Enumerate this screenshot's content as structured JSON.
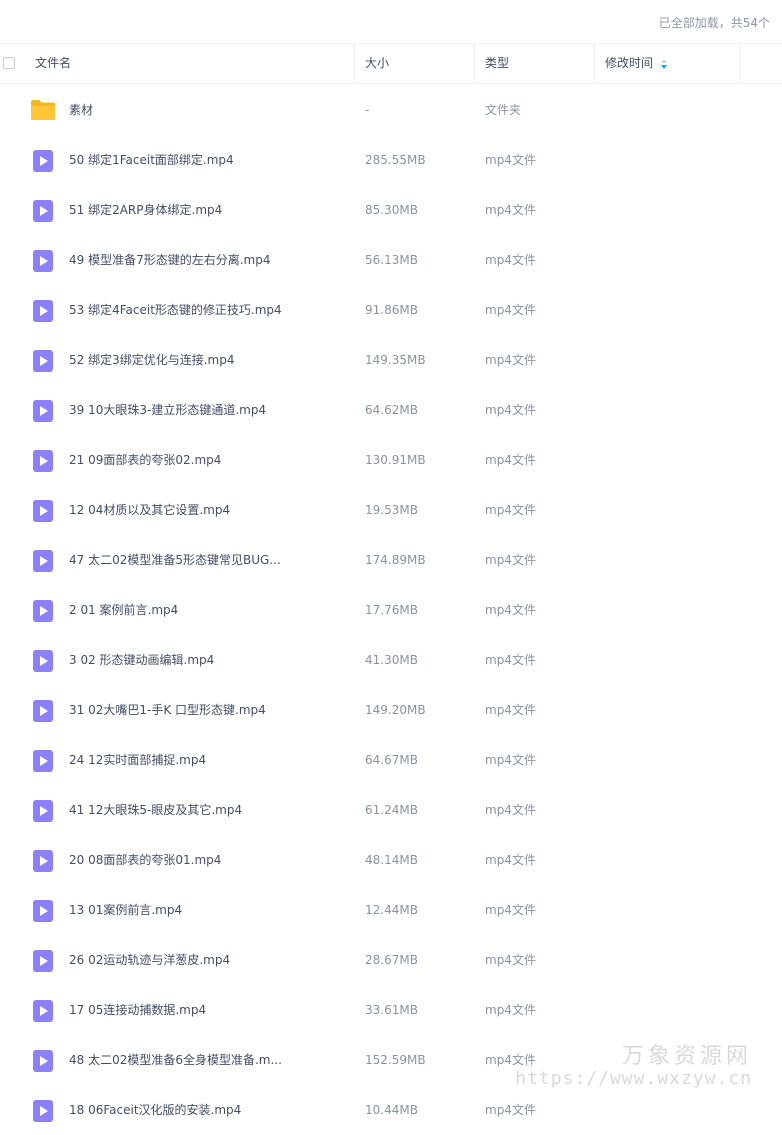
{
  "status": {
    "loaded_text": "已全部加载，共54个"
  },
  "columns": {
    "name": "文件名",
    "size": "大小",
    "type": "类型",
    "modified": "修改时间"
  },
  "icons": {
    "folder": "folder-icon",
    "video": "video-file-icon",
    "sort": "sort-icon"
  },
  "colors": {
    "folder": "#ffc536",
    "video": "#8b80f9",
    "sort_active": "#06a7ff"
  },
  "files": [
    {
      "name": "素材",
      "size": "-",
      "type": "文件夹",
      "kind": "folder"
    },
    {
      "name": "50 绑定1Faceit面部绑定.mp4",
      "size": "285.55MB",
      "type": "mp4文件",
      "kind": "video"
    },
    {
      "name": "51 绑定2ARP身体绑定.mp4",
      "size": "85.30MB",
      "type": "mp4文件",
      "kind": "video"
    },
    {
      "name": "49 模型准备7形态键的左右分离.mp4",
      "size": "56.13MB",
      "type": "mp4文件",
      "kind": "video"
    },
    {
      "name": "53 绑定4Faceit形态键的修正技巧.mp4",
      "size": "91.86MB",
      "type": "mp4文件",
      "kind": "video"
    },
    {
      "name": "52 绑定3绑定优化与连接.mp4",
      "size": "149.35MB",
      "type": "mp4文件",
      "kind": "video"
    },
    {
      "name": "39 10大眼珠3-建立形态键通道.mp4",
      "size": "64.62MB",
      "type": "mp4文件",
      "kind": "video"
    },
    {
      "name": "21 09面部表的夸张02.mp4",
      "size": "130.91MB",
      "type": "mp4文件",
      "kind": "video"
    },
    {
      "name": "12 04材质以及其它设置.mp4",
      "size": "19.53MB",
      "type": "mp4文件",
      "kind": "video"
    },
    {
      "name": "47 太二02模型准备5形态键常见BUG...",
      "size": "174.89MB",
      "type": "mp4文件",
      "kind": "video"
    },
    {
      "name": "2 01 案例前言.mp4",
      "size": "17.76MB",
      "type": "mp4文件",
      "kind": "video"
    },
    {
      "name": "3 02 形态键动画编辑.mp4",
      "size": "41.30MB",
      "type": "mp4文件",
      "kind": "video"
    },
    {
      "name": "31 02大嘴巴1-手K 口型形态键.mp4",
      "size": "149.20MB",
      "type": "mp4文件",
      "kind": "video"
    },
    {
      "name": "24 12实时面部捕捉.mp4",
      "size": "64.67MB",
      "type": "mp4文件",
      "kind": "video"
    },
    {
      "name": "41 12大眼珠5-眼皮及其它.mp4",
      "size": "61.24MB",
      "type": "mp4文件",
      "kind": "video"
    },
    {
      "name": "20 08面部表的夸张01.mp4",
      "size": "48.14MB",
      "type": "mp4文件",
      "kind": "video"
    },
    {
      "name": "13 01案例前言.mp4",
      "size": "12.44MB",
      "type": "mp4文件",
      "kind": "video"
    },
    {
      "name": "26 02运动轨迹与洋葱皮.mp4",
      "size": "28.67MB",
      "type": "mp4文件",
      "kind": "video"
    },
    {
      "name": "17 05连接动捕数据.mp4",
      "size": "33.61MB",
      "type": "mp4文件",
      "kind": "video"
    },
    {
      "name": "48 太二02模型准备6全身模型准备.m...",
      "size": "152.59MB",
      "type": "mp4文件",
      "kind": "video"
    },
    {
      "name": "18 06Faceit汉化版的安装.mp4",
      "size": "10.44MB",
      "type": "mp4文件",
      "kind": "video"
    }
  ],
  "watermark": {
    "title": "万象资源网",
    "url": "https://www.wxzyw.cn"
  }
}
